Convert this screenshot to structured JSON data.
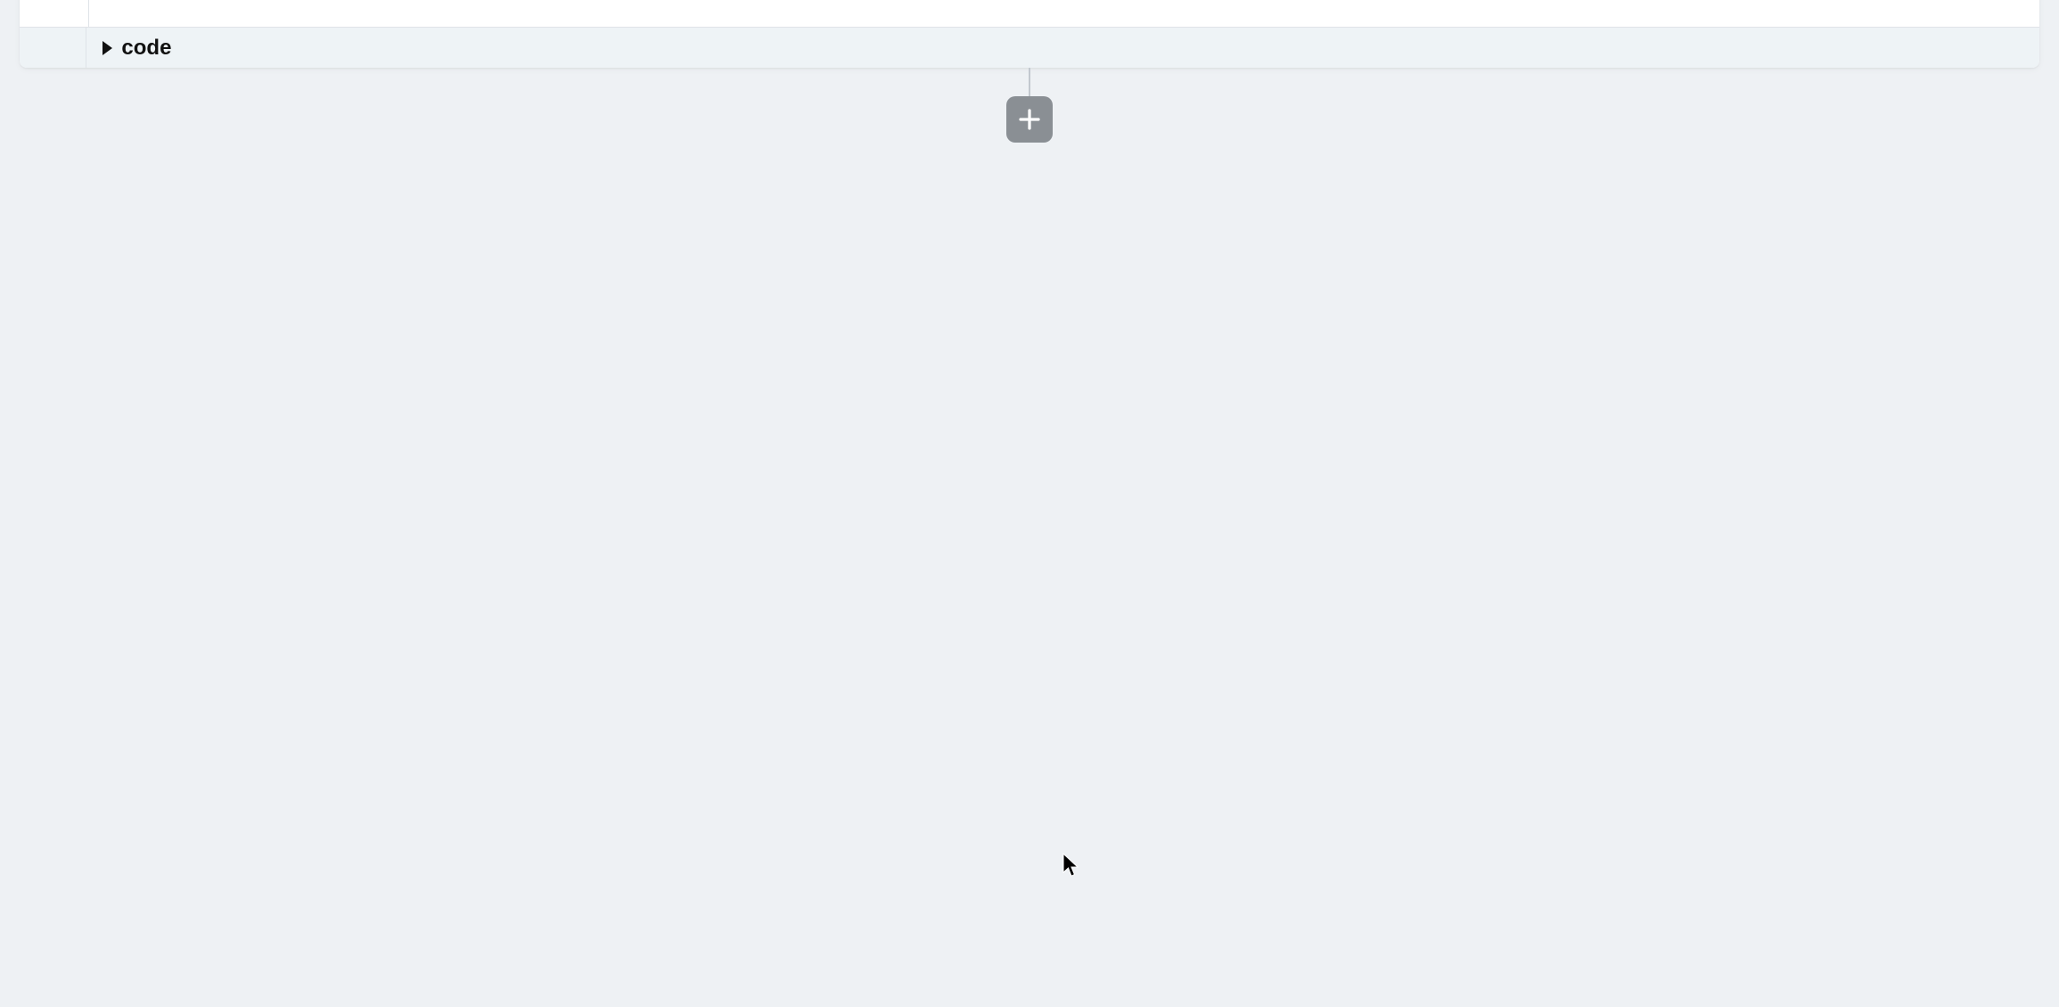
{
  "cell": {
    "code_toggle_label": "code"
  },
  "actions": {
    "add_cell_icon": "plus-icon"
  }
}
